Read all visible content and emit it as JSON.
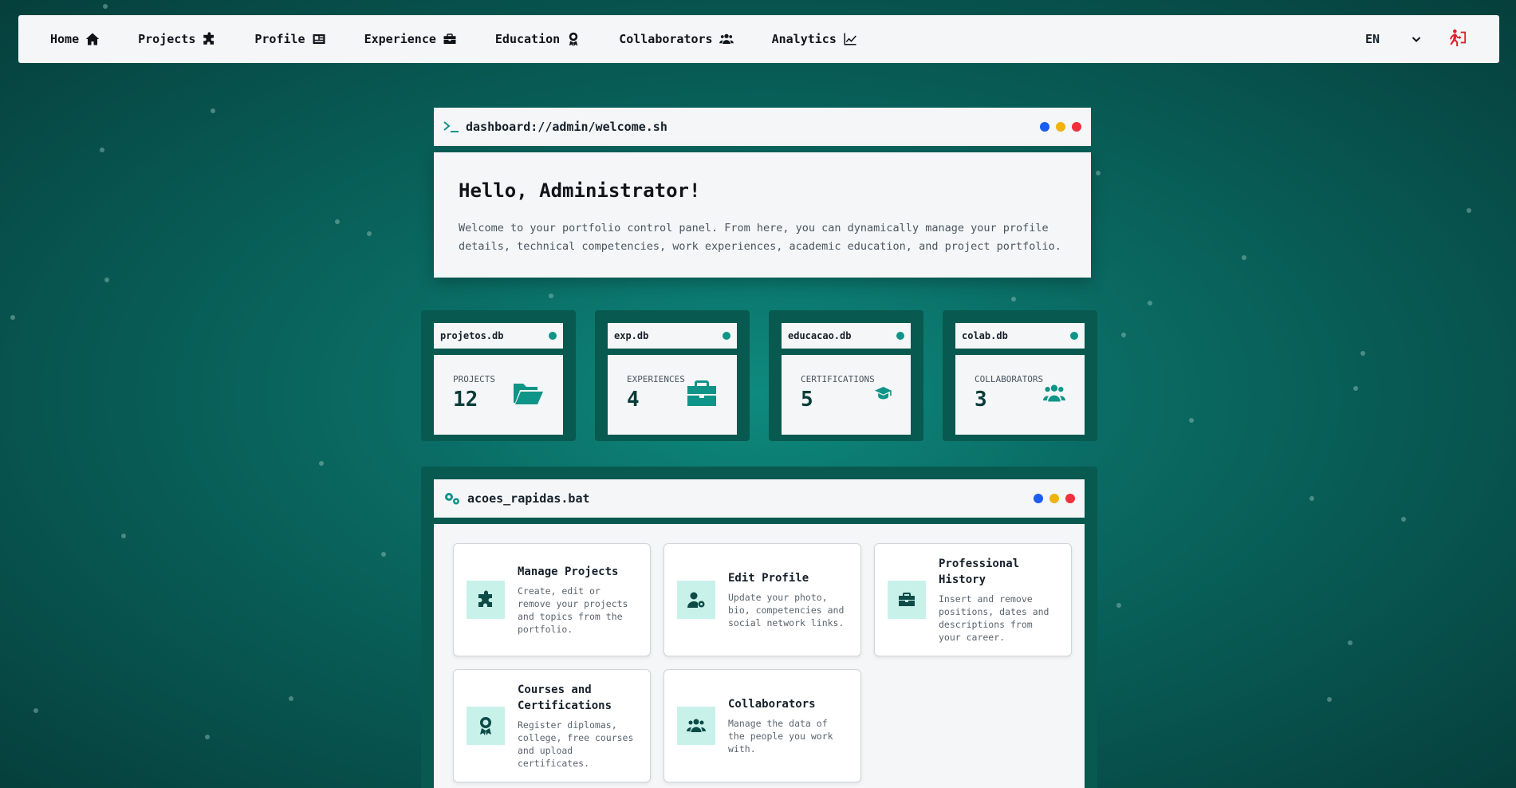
{
  "nav": {
    "items": [
      {
        "label": "Home",
        "icon": "home-icon"
      },
      {
        "label": "Projects",
        "icon": "puzzle-icon"
      },
      {
        "label": "Profile",
        "icon": "id-card-icon"
      },
      {
        "label": "Experience",
        "icon": "briefcase-icon"
      },
      {
        "label": "Education",
        "icon": "award-icon"
      },
      {
        "label": "Collaborators",
        "icon": "users-icon"
      },
      {
        "label": "Analytics",
        "icon": "chart-line-icon"
      }
    ],
    "language": "EN",
    "logout_color": "#e0202a"
  },
  "welcome": {
    "window_title": "dashboard://admin/welcome.sh",
    "heading": "Hello, Administrator!",
    "text": "Welcome to your portfolio control panel. From here, you can dynamically manage your profile details, technical competencies, work experiences, academic education, and project portfolio."
  },
  "stats": [
    {
      "file": "projetos.db",
      "label": "Projects",
      "value": "12",
      "icon": "folder-open-icon"
    },
    {
      "file": "exp.db",
      "label": "Experiences",
      "value": "4",
      "icon": "briefcase-icon"
    },
    {
      "file": "educacao.db",
      "label": "Certifications",
      "value": "5",
      "icon": "graduation-cap-icon"
    },
    {
      "file": "colab.db",
      "label": "Collaborators",
      "value": "3",
      "icon": "users-icon"
    }
  ],
  "actions": {
    "window_title": "acoes_rapidas.bat",
    "cards": [
      {
        "title": "Manage Projects",
        "desc": "Create, edit or remove your projects and topics from the portfolio.",
        "icon": "puzzle-icon"
      },
      {
        "title": "Edit Profile",
        "desc": "Update your photo, bio, competencies and social network links.",
        "icon": "user-gear-icon"
      },
      {
        "title": "Professional History",
        "desc": "Insert and remove positions, dates and descriptions from your career.",
        "icon": "briefcase-icon"
      },
      {
        "title": "Courses and Certifications",
        "desc": "Register diplomas, college, free courses and upload certificates.",
        "icon": "award-icon"
      },
      {
        "title": "Collaborators",
        "desc": "Manage the data of the people you work with.",
        "icon": "users-icon"
      }
    ]
  },
  "colors": {
    "accent": "#0f9488",
    "dot_blue": "#1d5cf0",
    "dot_yellow": "#f0b20c",
    "dot_red": "#f0303c"
  }
}
